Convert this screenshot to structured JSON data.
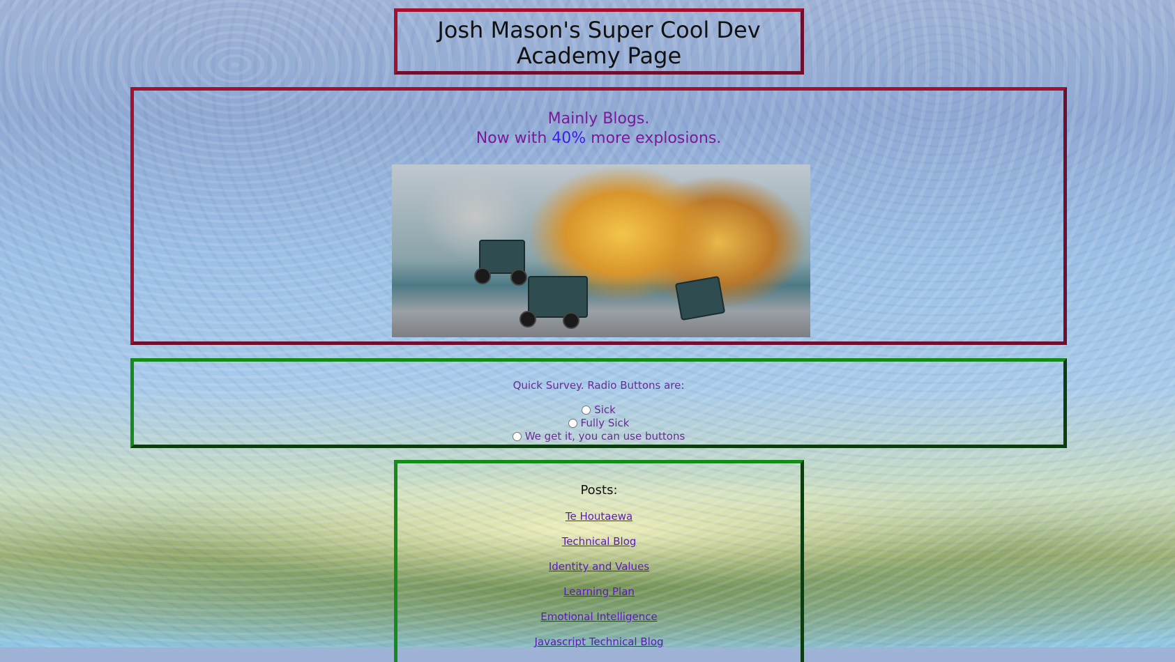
{
  "header": {
    "title": "Josh Mason's Super Cool Dev Academy Page"
  },
  "hero": {
    "tagline_line1": "Mainly Blogs.",
    "tagline_line2_prefix": "Now with ",
    "tagline_line2_highlight": "40%",
    "tagline_line2_suffix": " more explosions.",
    "image_icon": "explosion-gif"
  },
  "survey": {
    "question": "Quick Survey. Radio Buttons are:",
    "options": [
      "Sick",
      "Fully Sick",
      "We get it, you can use buttons"
    ]
  },
  "posts": {
    "heading": "Posts:",
    "links": [
      "Te Houtaewa",
      "Technical Blog",
      "Identity and Values",
      "Learning Plan",
      "Emotional Intelligence",
      "Javascript Technical Blog"
    ]
  },
  "colors": {
    "red_border": "#a3112f",
    "green_border": "#178a1c",
    "tagline": "#7a1a9a",
    "highlight": "#3b1cf0",
    "link": "#5a1ab8"
  }
}
